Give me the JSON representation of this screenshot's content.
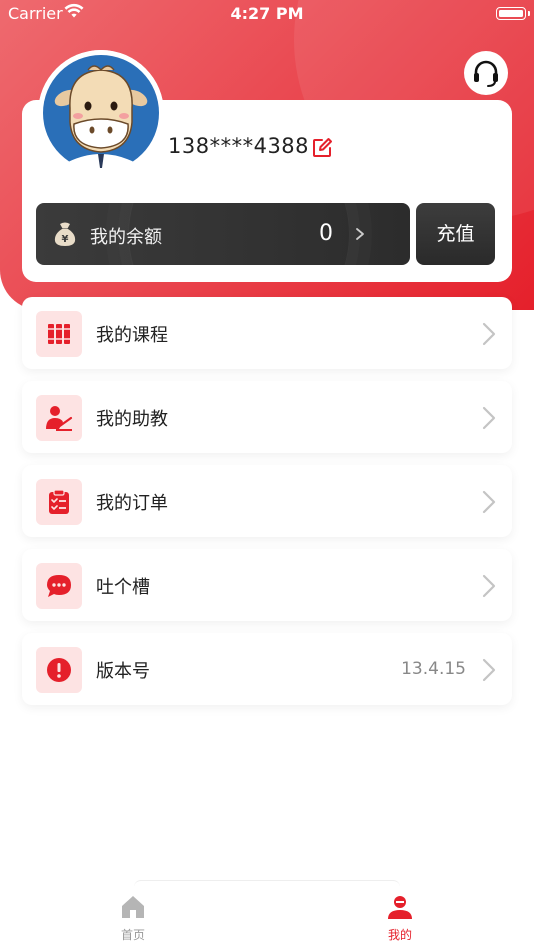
{
  "status_bar": {
    "carrier": "Carrier",
    "time": "4:27 PM"
  },
  "profile": {
    "phone": "138****4388"
  },
  "balance": {
    "label": "我的余额",
    "value": "0",
    "recharge_label": "充值"
  },
  "menu": {
    "items": [
      {
        "label": "我的课程",
        "icon": "books-icon"
      },
      {
        "label": "我的助教",
        "icon": "teacher-icon"
      },
      {
        "label": "我的订单",
        "icon": "clipboard-icon"
      },
      {
        "label": "吐个槽",
        "icon": "chat-bubble-icon"
      },
      {
        "label": "版本号",
        "icon": "exclamation-icon",
        "value": "13.4.15"
      }
    ]
  },
  "tabbar": {
    "items": [
      {
        "label": "首页",
        "icon": "home-icon",
        "active": false
      },
      {
        "label": "我的",
        "icon": "user-icon",
        "active": true
      }
    ]
  },
  "colors": {
    "accent": "#e5202b",
    "icon_bg": "#fde3e3",
    "dark_card": "#333333",
    "inactive": "#999999"
  }
}
